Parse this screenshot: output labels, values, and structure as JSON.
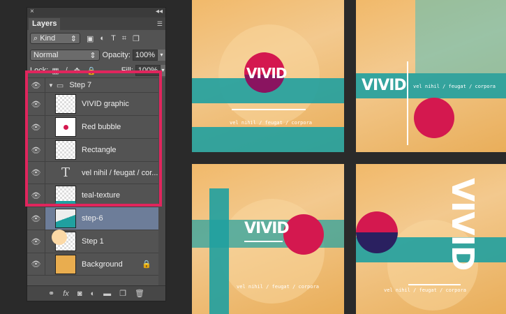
{
  "panel": {
    "close": "×",
    "collapse": "◂◂",
    "tab": "Layers",
    "menu": "☰",
    "filter": {
      "kind": "Kind",
      "search_icon": "⌕"
    },
    "blend_mode": "Normal",
    "opacity_label": "Opacity:",
    "opacity": "100%",
    "lock_label": "Lock:",
    "fill_label": "Fill:",
    "fill": "100%",
    "layers": [
      {
        "name": "Step 7",
        "type": "group"
      },
      {
        "name": "VIVID graphic",
        "type": "smart"
      },
      {
        "name": "Red bubble",
        "type": "shape"
      },
      {
        "name": "Rectangle",
        "type": "shape"
      },
      {
        "name": "vel nihil / feugat / cor...",
        "type": "text"
      },
      {
        "name": "teal-texture",
        "type": "pixel"
      },
      {
        "name": "step-6",
        "type": "smart",
        "selected": true
      },
      {
        "name": "Step 1",
        "type": "smart"
      },
      {
        "name": "Background",
        "type": "pixel",
        "locked": true
      }
    ]
  },
  "canvas": {
    "title": "VIVID",
    "subtitle": "vel nihil / feugat / corpora"
  },
  "colors": {
    "highlight": "#e0255d",
    "teal": "#1fa0a0",
    "magenta": "#d4184f"
  }
}
